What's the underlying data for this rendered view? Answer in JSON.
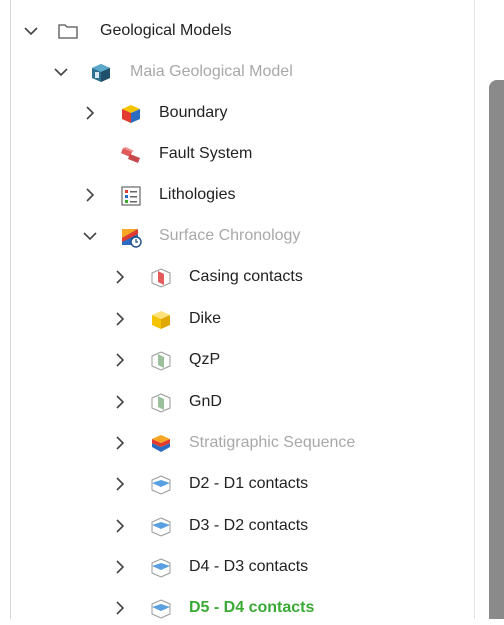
{
  "tree": {
    "root": {
      "label": "Geological Models",
      "icon": "folder-icon",
      "expanded": true
    },
    "model": {
      "label": "Maia Geological Model",
      "icon": "geological-model-icon",
      "expanded": true
    },
    "boundary": {
      "label": "Boundary",
      "icon": "boundary-icon"
    },
    "fault_system": {
      "label": "Fault System",
      "icon": "fault-system-icon"
    },
    "lithologies": {
      "label": "Lithologies",
      "icon": "lithologies-list-icon"
    },
    "surface_chronology": {
      "label": "Surface Chronology",
      "icon": "surface-chronology-icon",
      "expanded": true
    },
    "children": [
      {
        "label": "Casing contacts",
        "icon": "red-contact-surface-icon"
      },
      {
        "label": "Dike",
        "icon": "yellow-dike-icon"
      },
      {
        "label": "QzP",
        "icon": "green-contact-surface-icon"
      },
      {
        "label": "GnD",
        "icon": "green-contact-surface-icon"
      },
      {
        "label": "Stratigraphic Sequence",
        "icon": "stratigraphic-sequence-icon"
      },
      {
        "label": "D2 - D1 contacts",
        "icon": "blue-contact-surface-icon"
      },
      {
        "label": "D3 - D2 contacts",
        "icon": "blue-contact-surface-icon"
      },
      {
        "label": "D4 - D3 contacts",
        "icon": "blue-contact-surface-icon"
      },
      {
        "label": "D5 - D4 contacts",
        "icon": "blue-contact-surface-icon"
      }
    ]
  },
  "colors": {
    "text": "#222222",
    "dimmed": "#a8a8a8",
    "active": "#3aaa35"
  }
}
